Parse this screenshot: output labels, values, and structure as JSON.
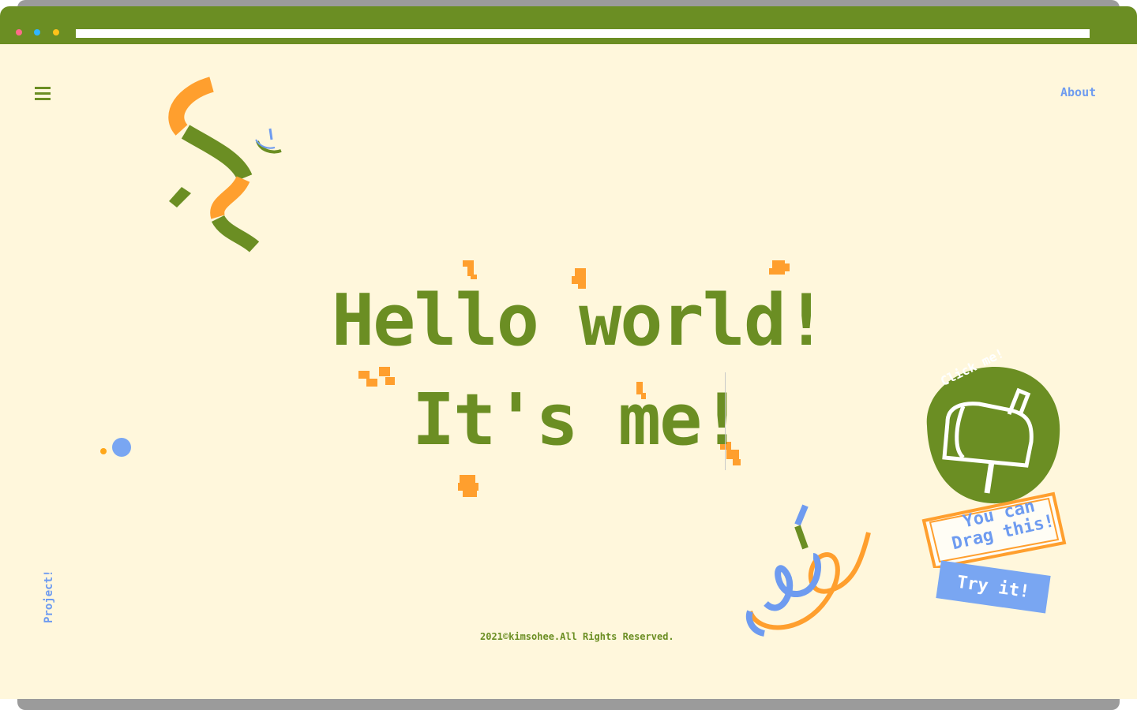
{
  "browser": {
    "address_value": "",
    "dots": [
      "#ff6b8a",
      "#2fb5ff",
      "#ffc21a"
    ]
  },
  "nav": {
    "menu_icon": "hamburger-icon",
    "about_label": "About",
    "project_label": "Project!"
  },
  "hero": {
    "line1": "Hello world!",
    "line2": "It's me!"
  },
  "mailbox": {
    "circle_text": "Click me!",
    "stamp_text": "You can Drag this!",
    "stamp_line1": "You can",
    "stamp_line2": "Drag this!",
    "try_label": "Try it!"
  },
  "footer": {
    "copyright": "2021©kimsohee.All Rights Reserved."
  },
  "colors": {
    "brand_green": "#6b8e23",
    "accent_orange": "#ff9f2e",
    "accent_blue": "#6e9bf0",
    "background": "#fff7dc"
  }
}
